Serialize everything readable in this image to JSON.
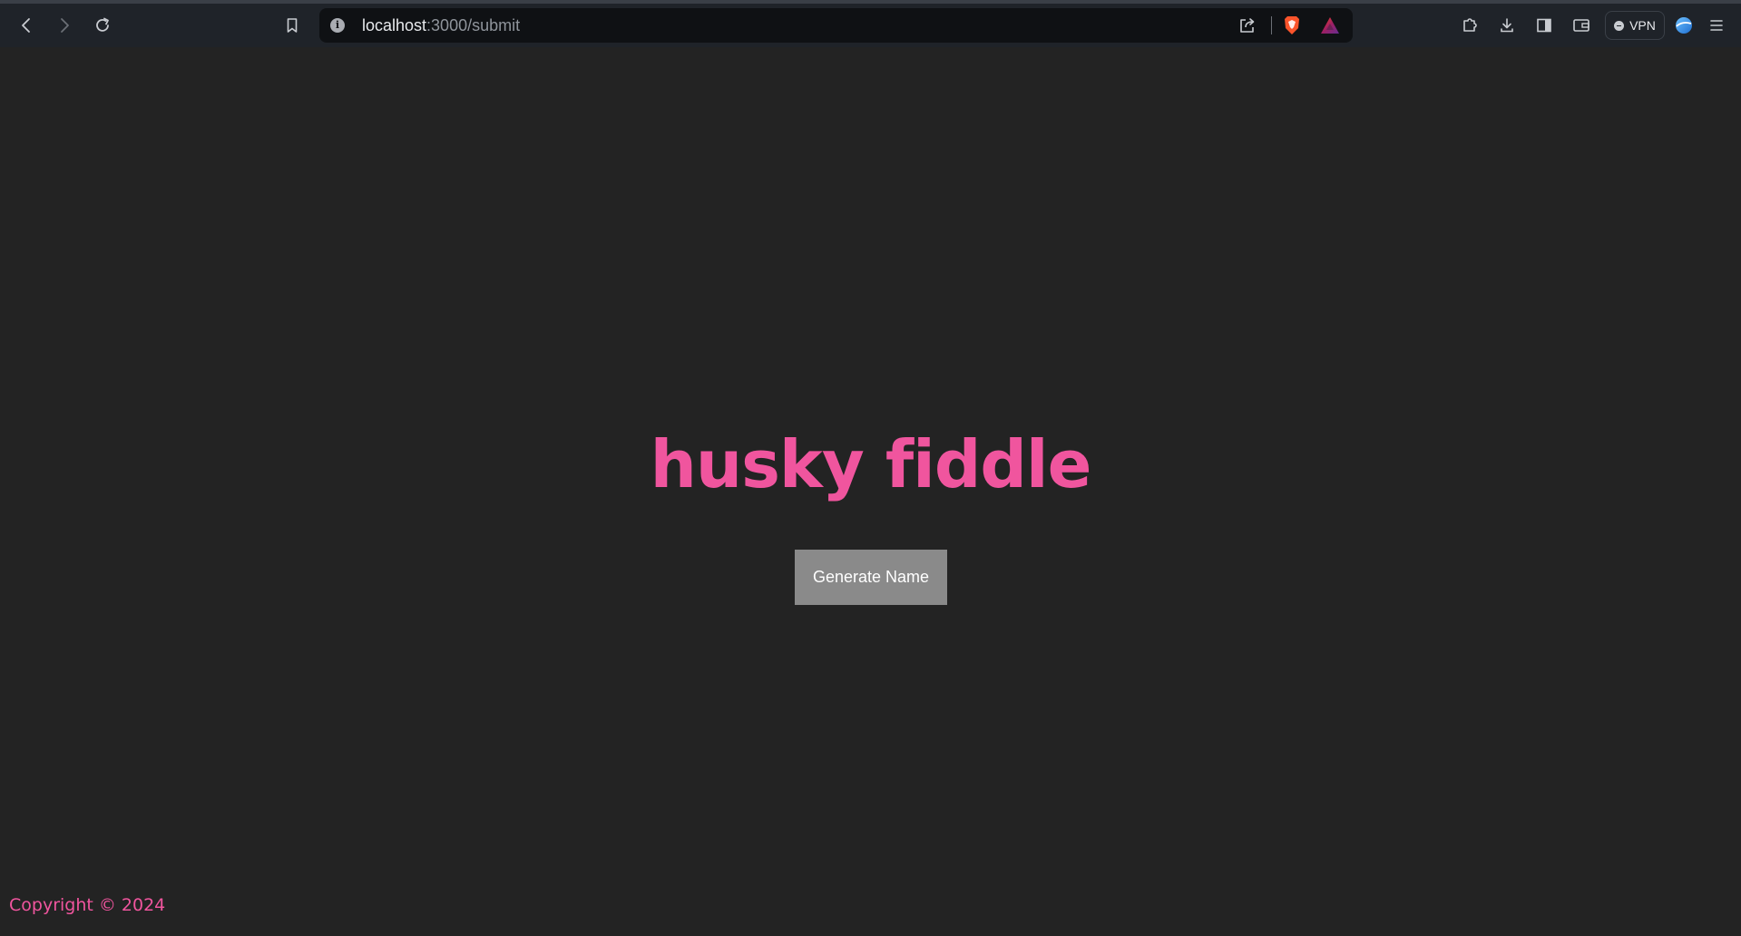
{
  "browser": {
    "url_host": "localhost",
    "url_rest": ":3000/submit",
    "vpn_label": "VPN",
    "url_info_glyph": "i",
    "icons": {
      "back": "back-arrow-icon",
      "forward": "forward-arrow-icon",
      "reload": "reload-icon",
      "bookmark": "bookmark-icon",
      "share": "share-icon",
      "brave_shields": "brave-lion-icon",
      "brave_rewards": "rewards-triangle-icon",
      "extensions": "puzzle-icon",
      "downloads": "download-icon",
      "sidebar": "sidebar-icon",
      "wallet": "wallet-icon",
      "profile": "globe-profile-icon",
      "menu": "hamburger-menu-icon"
    }
  },
  "page": {
    "title": "husky fiddle",
    "button_label": "Generate Name",
    "footer": "Copyright © 2024"
  },
  "colors": {
    "background": "#232323",
    "accent": "#f0559e",
    "button_bg": "#8a8a8a",
    "toolbar_bg": "#1f2329",
    "urlbar_bg": "#0f1114"
  }
}
